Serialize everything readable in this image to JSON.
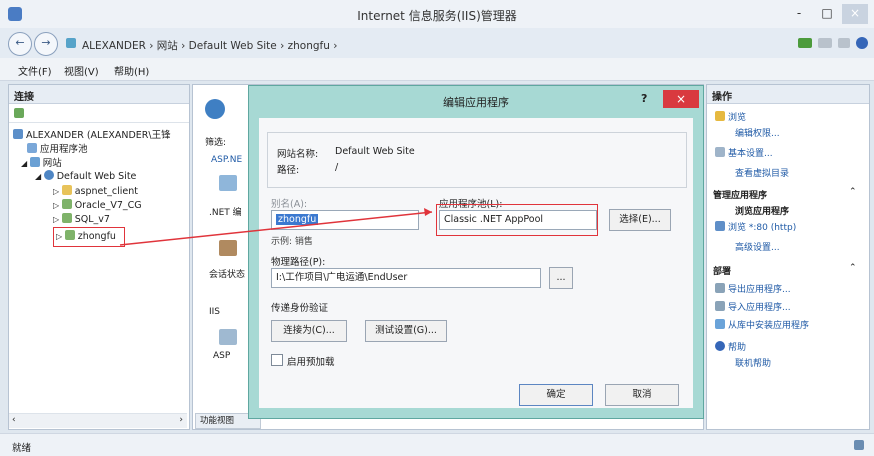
{
  "window": {
    "title": "Internet 信息服务(IIS)管理器",
    "min": "-",
    "max": "□",
    "close": "×"
  },
  "address": {
    "path": "ALEXANDER  ›  网站  ›  Default Web Site  ›  zhongfu  ›"
  },
  "menu": {
    "file": "文件(F)",
    "view": "视图(V)",
    "help": "帮助(H)"
  },
  "connections": {
    "header": "连接",
    "items": [
      "ALEXANDER (ALEXANDER\\王锋",
      "应用程序池",
      "网站",
      "Default Web Site",
      "aspnet_client",
      "Oracle_V7_CG",
      "SQL_v7",
      "zhongfu"
    ]
  },
  "center": {
    "filter": "筛选:",
    "aspnet": "ASP.NE",
    "net": ".NET 编",
    "session": "会话状态",
    "iis": "IIS",
    "asp": "ASP",
    "tab": "功能视图"
  },
  "dialog": {
    "title": "编辑应用程序",
    "help": "?",
    "close": "×",
    "site_label": "网站名称:",
    "site_value": "Default Web Site",
    "path_label": "路径:",
    "path_value": "/",
    "alias_label": "别名(A):",
    "alias_value": "zhongfu",
    "example": "示例: 销售",
    "pool_label": "应用程序池(L):",
    "pool_value": "Classic .NET AppPool",
    "select_btn": "选择(E)...",
    "phys_label": "物理路径(P):",
    "phys_value": "I:\\工作项目\\广电运通\\EndUser",
    "browse": "...",
    "auth_label": "传递身份验证",
    "connect_as": "连接为(C)...",
    "test": "测试设置(G)...",
    "preload": "启用预加载",
    "ok": "确定",
    "cancel": "取消"
  },
  "actions": {
    "header": "操作",
    "browse": "浏览",
    "edit_perm": "编辑权限...",
    "basic": "基本设置...",
    "virtual": "查看虚拟目录",
    "manage_app": "管理应用程序",
    "browse_app": "浏览应用程序",
    "browse_80": "浏览 *:80 (http)",
    "advanced": "高级设置...",
    "deploy": "部署",
    "export": "导出应用程序...",
    "import": "导入应用程序...",
    "install_lib": "从库中安装应用程序",
    "help": "帮助",
    "online_help": "联机帮助"
  },
  "status": {
    "text": "就绪"
  }
}
